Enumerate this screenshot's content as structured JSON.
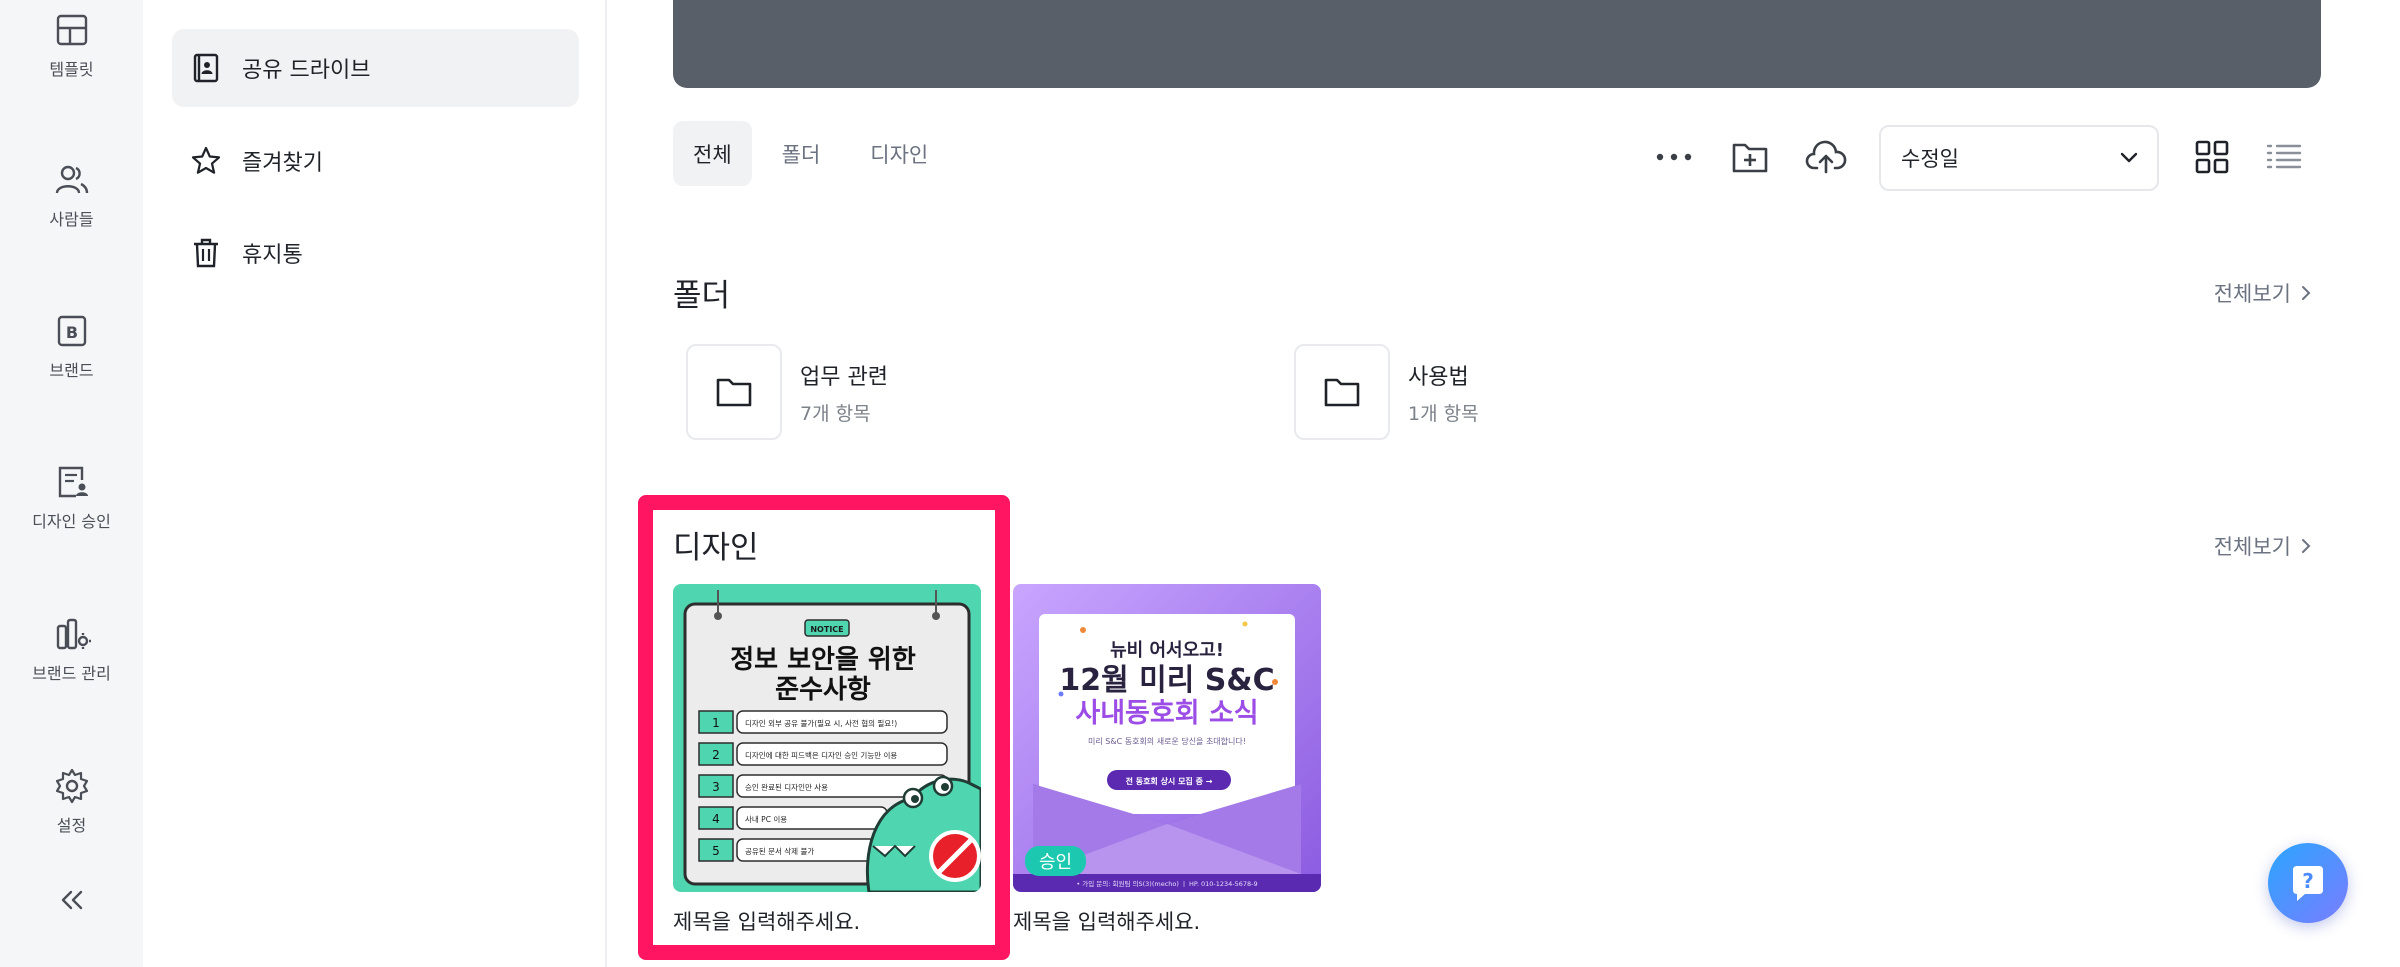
{
  "rail": {
    "items": [
      {
        "label": "템플릿",
        "icon": "template-icon"
      },
      {
        "label": "사람들",
        "icon": "people-icon"
      },
      {
        "label": "브랜드",
        "icon": "brand-icon"
      },
      {
        "label": "디자인 승인",
        "icon": "design-approval-icon"
      },
      {
        "label": "브랜드 관리",
        "icon": "brand-manage-icon"
      },
      {
        "label": "설정",
        "icon": "gear-icon"
      }
    ],
    "collapse_icon": "double-chevron-left-icon"
  },
  "sidenav": {
    "items": [
      {
        "label": "공유 드라이브",
        "icon": "shared-drive-icon",
        "active": true
      },
      {
        "label": "즐겨찾기",
        "icon": "star-icon",
        "active": false
      },
      {
        "label": "휴지통",
        "icon": "trash-icon",
        "active": false
      }
    ]
  },
  "filters": {
    "tabs": [
      {
        "label": "전체",
        "active": true
      },
      {
        "label": "폴더",
        "active": false
      },
      {
        "label": "디자인",
        "active": false
      }
    ]
  },
  "toolbar": {
    "icons": [
      "more-icon",
      "new-folder-icon",
      "upload-cloud-icon",
      "grid-view-icon",
      "list-view-icon"
    ],
    "sort_value": "수정일"
  },
  "folders_section": {
    "title": "폴더",
    "see_all": "전체보기",
    "folders": [
      {
        "name": "업무 관련",
        "count": "7개 항목"
      },
      {
        "name": "사용법",
        "count": "1개 항목"
      }
    ]
  },
  "designs_section": {
    "title": "디자인",
    "see_all": "전체보기",
    "designs": [
      {
        "title": "제목을 입력해주세요.",
        "thumb": {
          "tag": "NOTICE",
          "headline1": "정보 보안을 위한",
          "headline2": "준수사항",
          "rules": [
            {
              "num": "1",
              "text": "디자인 외부 공유 불가(필요 시, 사전 협의 필요!)"
            },
            {
              "num": "2",
              "text": "디자인에 대한 피드백은 디자인 승인 기능만 이용"
            },
            {
              "num": "3",
              "text": "승인 완료된 디자인만 사용"
            },
            {
              "num": "4",
              "text": "사내 PC 이용"
            },
            {
              "num": "5",
              "text": "공유된 문서 삭제 불가"
            }
          ]
        }
      },
      {
        "title": "제목을 입력해주세요.",
        "badge": "승인",
        "thumb": {
          "line1": "뉴비 어서오고!",
          "line2": "12월 미리 S&C",
          "line3": "사내동호회 소식",
          "sub": "미리 S&C 동호회의 새로운 당신을 초대합니다!",
          "button": "전 동호회 상시 모집 중 →",
          "footer": "• 가입 문의: 회원팀 의S(3)(mecho) ㅣ HP. 010-1234-5678-9"
        }
      }
    ]
  },
  "help": {
    "icon": "help-chat-icon"
  },
  "colors": {
    "highlight": "#ff1561",
    "banner": "#585f68",
    "badge": "#1cc9b0"
  }
}
